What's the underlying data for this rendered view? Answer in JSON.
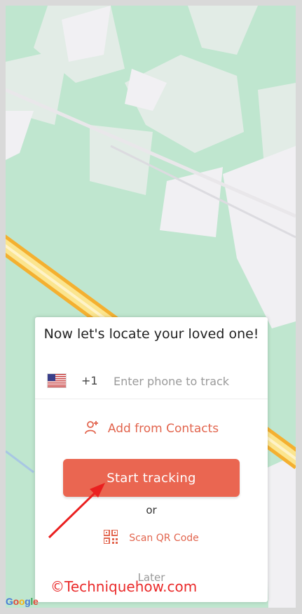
{
  "map": {
    "land_color": "#bfe6cf",
    "road_color": "#f4f2f5",
    "highway_color": "#f8c74a",
    "attribution": "Google"
  },
  "card": {
    "title": "Now let's locate your loved one!",
    "country_code": "+1",
    "flag_icon": "us-flag-icon",
    "phone_placeholder": "Enter phone to track",
    "phone_value": "",
    "add_contacts_label": "Add from Contacts",
    "start_button_label": "Start tracking",
    "or_label": "or",
    "scan_qr_label": "Scan QR Code",
    "later_label": "Later"
  },
  "overlay": {
    "watermark": "©Techniquehow.com",
    "arrow_color": "#ea1f1f"
  },
  "colors": {
    "accent": "#ea6651",
    "accent_text": "#e2654e"
  }
}
